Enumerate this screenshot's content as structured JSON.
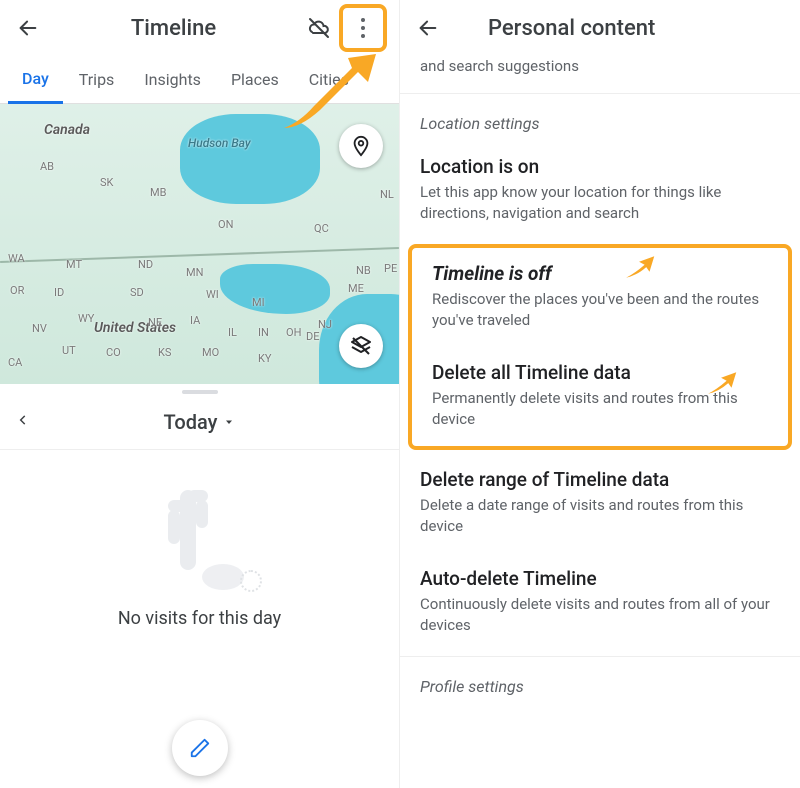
{
  "left": {
    "title": "Timeline",
    "tabs": [
      "Day",
      "Trips",
      "Insights",
      "Places",
      "Cities"
    ],
    "active_tab_index": 0,
    "map": {
      "labels": {
        "canada": "Canada",
        "hudson_bay": "Hudson Bay",
        "united_states": "United States",
        "ab": "AB",
        "sk": "SK",
        "mb": "MB",
        "on": "ON",
        "qc": "QC",
        "nl": "NL",
        "wa": "WA",
        "mt": "MT",
        "nd": "ND",
        "mn": "MN",
        "me": "ME",
        "or": "OR",
        "id": "ID",
        "sd": "SD",
        "wi": "WI",
        "mi": "MI",
        "nb": "NB",
        "pe": "PE",
        "nv": "NV",
        "wy": "WY",
        "ne": "NE",
        "ia": "IA",
        "il": "IL",
        "in": "IN",
        "oh": "OH",
        "ca": "CA",
        "ut": "UT",
        "co": "CO",
        "ks": "KS",
        "mo": "MO",
        "ky": "KY",
        "de": "DE",
        "nj": "NJ"
      }
    },
    "date_label": "Today",
    "empty_text": "No visits for this day"
  },
  "right": {
    "title": "Personal content",
    "truncated_top": "and search suggestions",
    "section_label": "Location settings",
    "items": [
      {
        "title": "Location is on",
        "desc": "Let this app know your location for things like directions, navigation and search"
      },
      {
        "title": "Timeline is off",
        "desc": "Rediscover the places you've been and the routes you've traveled"
      },
      {
        "title": "Delete all Timeline data",
        "desc": "Permanently delete visits and routes from this device"
      },
      {
        "title": "Delete range of Timeline data",
        "desc": "Delete a date range of visits and routes from this device"
      },
      {
        "title": "Auto-delete Timeline",
        "desc": "Continuously delete visits and routes from all of your devices"
      }
    ],
    "truncated_bottom": "Profile settings"
  }
}
